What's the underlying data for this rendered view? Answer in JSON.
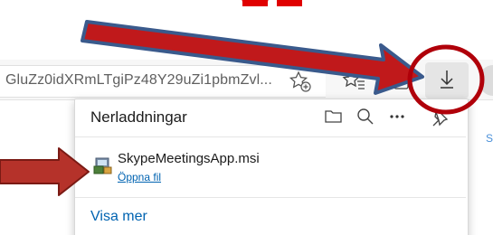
{
  "browser": {
    "address_text": "GluZz0idXRmLTgiPz48Y29uZi1pbmZvl...",
    "side_letter": "S"
  },
  "toolbar_icons": [
    "add-favorite-icon",
    "favorites-icon",
    "collections-icon",
    "download-icon"
  ],
  "downloads_panel": {
    "title": "Nerladdningar",
    "header_icons": [
      "open-folder-icon",
      "search-icon",
      "more-icon",
      "pin-icon"
    ],
    "file": {
      "name": "SkypeMeetingsApp.msi",
      "action": "Öppna fil",
      "icon": "installer-package-icon"
    },
    "show_more": "Visa mer"
  },
  "annotation_colors": {
    "top_letters": "#e00000",
    "arrow_fill": "#c0191b",
    "arrow_outline": "#3a5a8c",
    "circle": "#b0000a",
    "left_arrow_fill": "#b5322a",
    "left_arrow_outline": "#7a1a14"
  }
}
